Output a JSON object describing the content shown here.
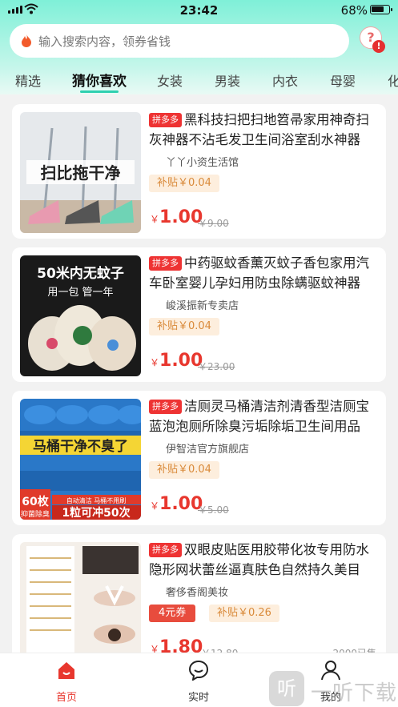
{
  "status": {
    "time": "23:42",
    "battery": "68%"
  },
  "search": {
    "placeholder": "输入搜索内容，领券省钱"
  },
  "tabs": [
    "精选",
    "猜你喜欢",
    "女装",
    "男装",
    "内衣",
    "母婴",
    "化"
  ],
  "active_tab": "猜你喜欢",
  "products": [
    {
      "badge": "拼多多",
      "title": "黑科技扫把扫地笤帚家用神奇扫灰神器不沾毛发卫生间浴室刮水神器",
      "shop": "丫丫小资生活馆",
      "subsidy": "补贴￥0.04",
      "coupon": "",
      "currency": "￥",
      "price": "1.00",
      "original": "￥9.00",
      "sold": "",
      "image_text": "扫比拖干净"
    },
    {
      "badge": "拼多多",
      "title": "中药驱蚊香薰灭蚊子香包家用汽车卧室婴儿孕妇用防虫除螨驱蚊神器",
      "shop": "峻溪振新专卖店",
      "subsidy": "补贴￥0.04",
      "coupon": "",
      "currency": "￥",
      "price": "1.00",
      "original": "￥23.00",
      "sold": "",
      "image_text": "50米内无蚊子",
      "image_text2": "用一包 管一年"
    },
    {
      "badge": "拼多多",
      "title": "洁厕灵马桶清洁剂清香型洁厕宝蓝泡泡厕所除臭污垢除垢卫生间用品",
      "shop": "伊智洁官方旗舰店",
      "subsidy": "补贴￥0.04",
      "coupon": "",
      "currency": "￥",
      "price": "1.00",
      "original": "￥5.00",
      "sold": "",
      "image_text": "马桶干净不臭了",
      "image_text2": "1粒可冲50次",
      "image_text3": "60枚",
      "image_text4": "抑菌除臭",
      "image_text5": "自动清洁 马桶不用刷"
    },
    {
      "badge": "拼多多",
      "title": "双眼皮贴医用胶带化妆专用防水隐形网状蕾丝逼真肤色自然持久美目",
      "shop": "奢侈香阁美妆",
      "subsidy": "补贴￥0.26",
      "coupon": "4元券",
      "currency": "￥",
      "price": "1.80",
      "original": "￥12.80",
      "sold": "2000已售",
      "image_text": ""
    }
  ],
  "bottom_nav": [
    {
      "label": "首页",
      "icon": "home-icon"
    },
    {
      "label": "实时",
      "icon": "chat-icon"
    },
    {
      "label": "我的",
      "icon": "user-icon"
    }
  ],
  "watermark": "一听下载",
  "colors": {
    "accent": "#2fd0b0",
    "price": "#e8372e",
    "badge": "#e33333"
  }
}
